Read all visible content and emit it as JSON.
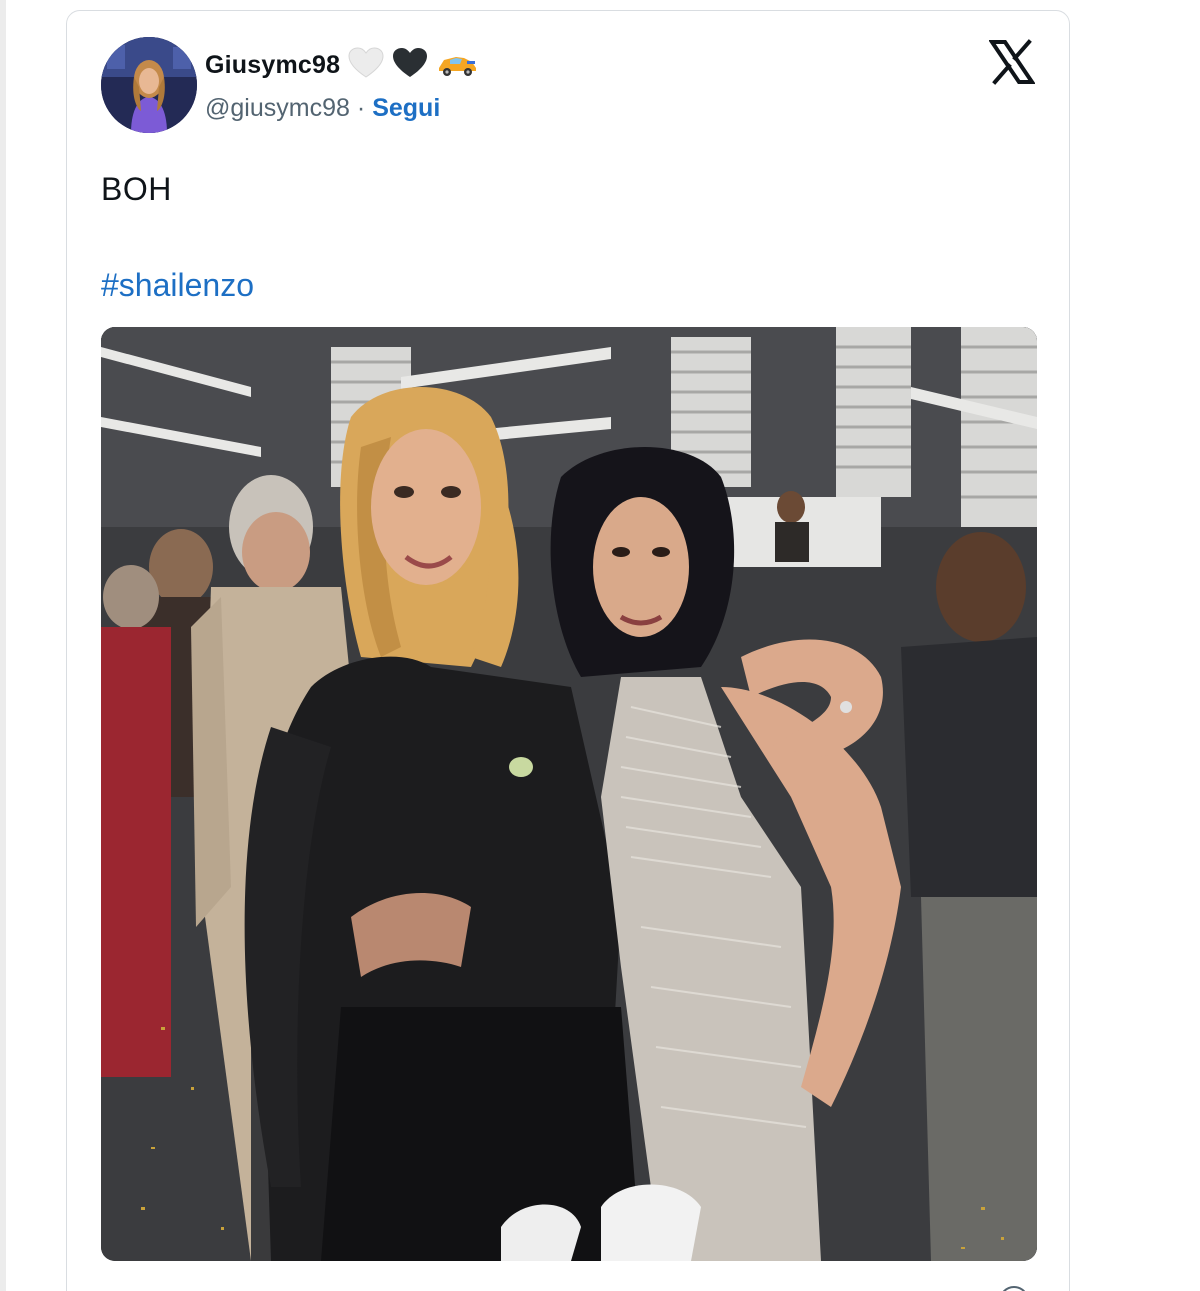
{
  "tweet": {
    "author": {
      "display_name": "Giusymc98",
      "handle": "@giusymc98",
      "name_emojis": [
        "white-heart-icon",
        "black-heart-icon",
        "race-car-icon"
      ]
    },
    "separator": "·",
    "follow_label": "Segui",
    "text": "BOH",
    "hashtag": "#shailenzo",
    "photo": {
      "subject": "two-women-posing-at-event-photo"
    },
    "brand_icon": "x-logo-icon",
    "footer_info_icon": "info-icon"
  },
  "colors": {
    "link_blue": "#1d6fc4",
    "text_primary": "#0f1419",
    "text_secondary": "#536471",
    "card_border": "#d9dde1"
  }
}
